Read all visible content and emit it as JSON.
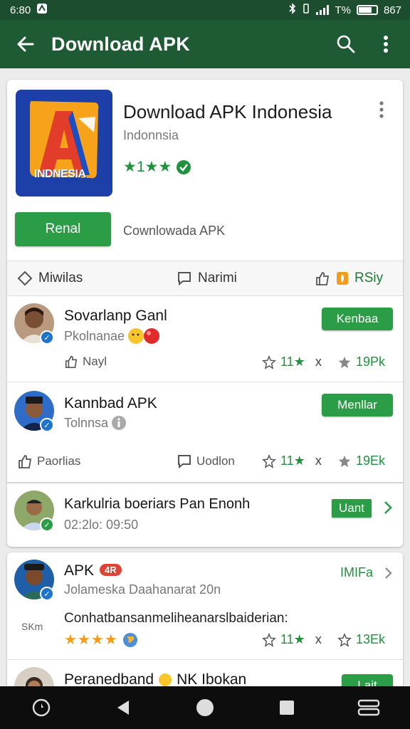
{
  "status_bar": {
    "time": "6:80",
    "battery_percent": "T%",
    "extra": "867"
  },
  "app_bar": {
    "title": "Download APK"
  },
  "hero": {
    "app_name": "Download APK Indonesia",
    "developer": "Indonnsia",
    "rating_text": "★1★★",
    "icon_text": "INDNESIA",
    "install_label": "Renal",
    "install_note": "Cownlowada APK"
  },
  "tabs": [
    {
      "label": "Miwilas",
      "icon": "tag-icon"
    },
    {
      "label": "Narimi",
      "icon": "comment-icon"
    },
    {
      "label": "RSiy",
      "icon": "thumbs-up-icon"
    }
  ],
  "items": [
    {
      "name": "Sovarlanp Ganl",
      "meta": "Pkolnanae",
      "button": "Kenbaa",
      "actions": {
        "like": "Nayl",
        "stars": "11★",
        "x": "x",
        "downloads": "19Pk"
      }
    },
    {
      "name": "Kannbad APK",
      "meta": "Tolnnsa",
      "button": "Menllar",
      "actions": {
        "like": "Paorlias",
        "comment": "Uodlon",
        "stars": "11★",
        "x": "x",
        "downloads": "19Ek"
      }
    },
    {
      "name": "Karkulria boeriars Pan Enonh",
      "meta": "02:2lo: 09:50",
      "button": "Uant"
    }
  ],
  "card2": [
    {
      "name": "APK",
      "badge": "4R",
      "meta": "Jolameska Daahanarat 20n",
      "action_label": "IMIFa",
      "description": "Conhatbansanmeliheanarslbaiderian:",
      "left_tag": "SKm",
      "rating_stars": "★★★★",
      "actions": {
        "stars": "11★",
        "x": "x",
        "downloads": "13Ek"
      }
    },
    {
      "name": "Peranedband",
      "name_suffix": "NK Ibokan",
      "button": "Lait"
    }
  ],
  "colors": {
    "brand_green": "#1e5a33",
    "accent_green": "#2a9d46",
    "status_bar": "#1d4d2f"
  }
}
